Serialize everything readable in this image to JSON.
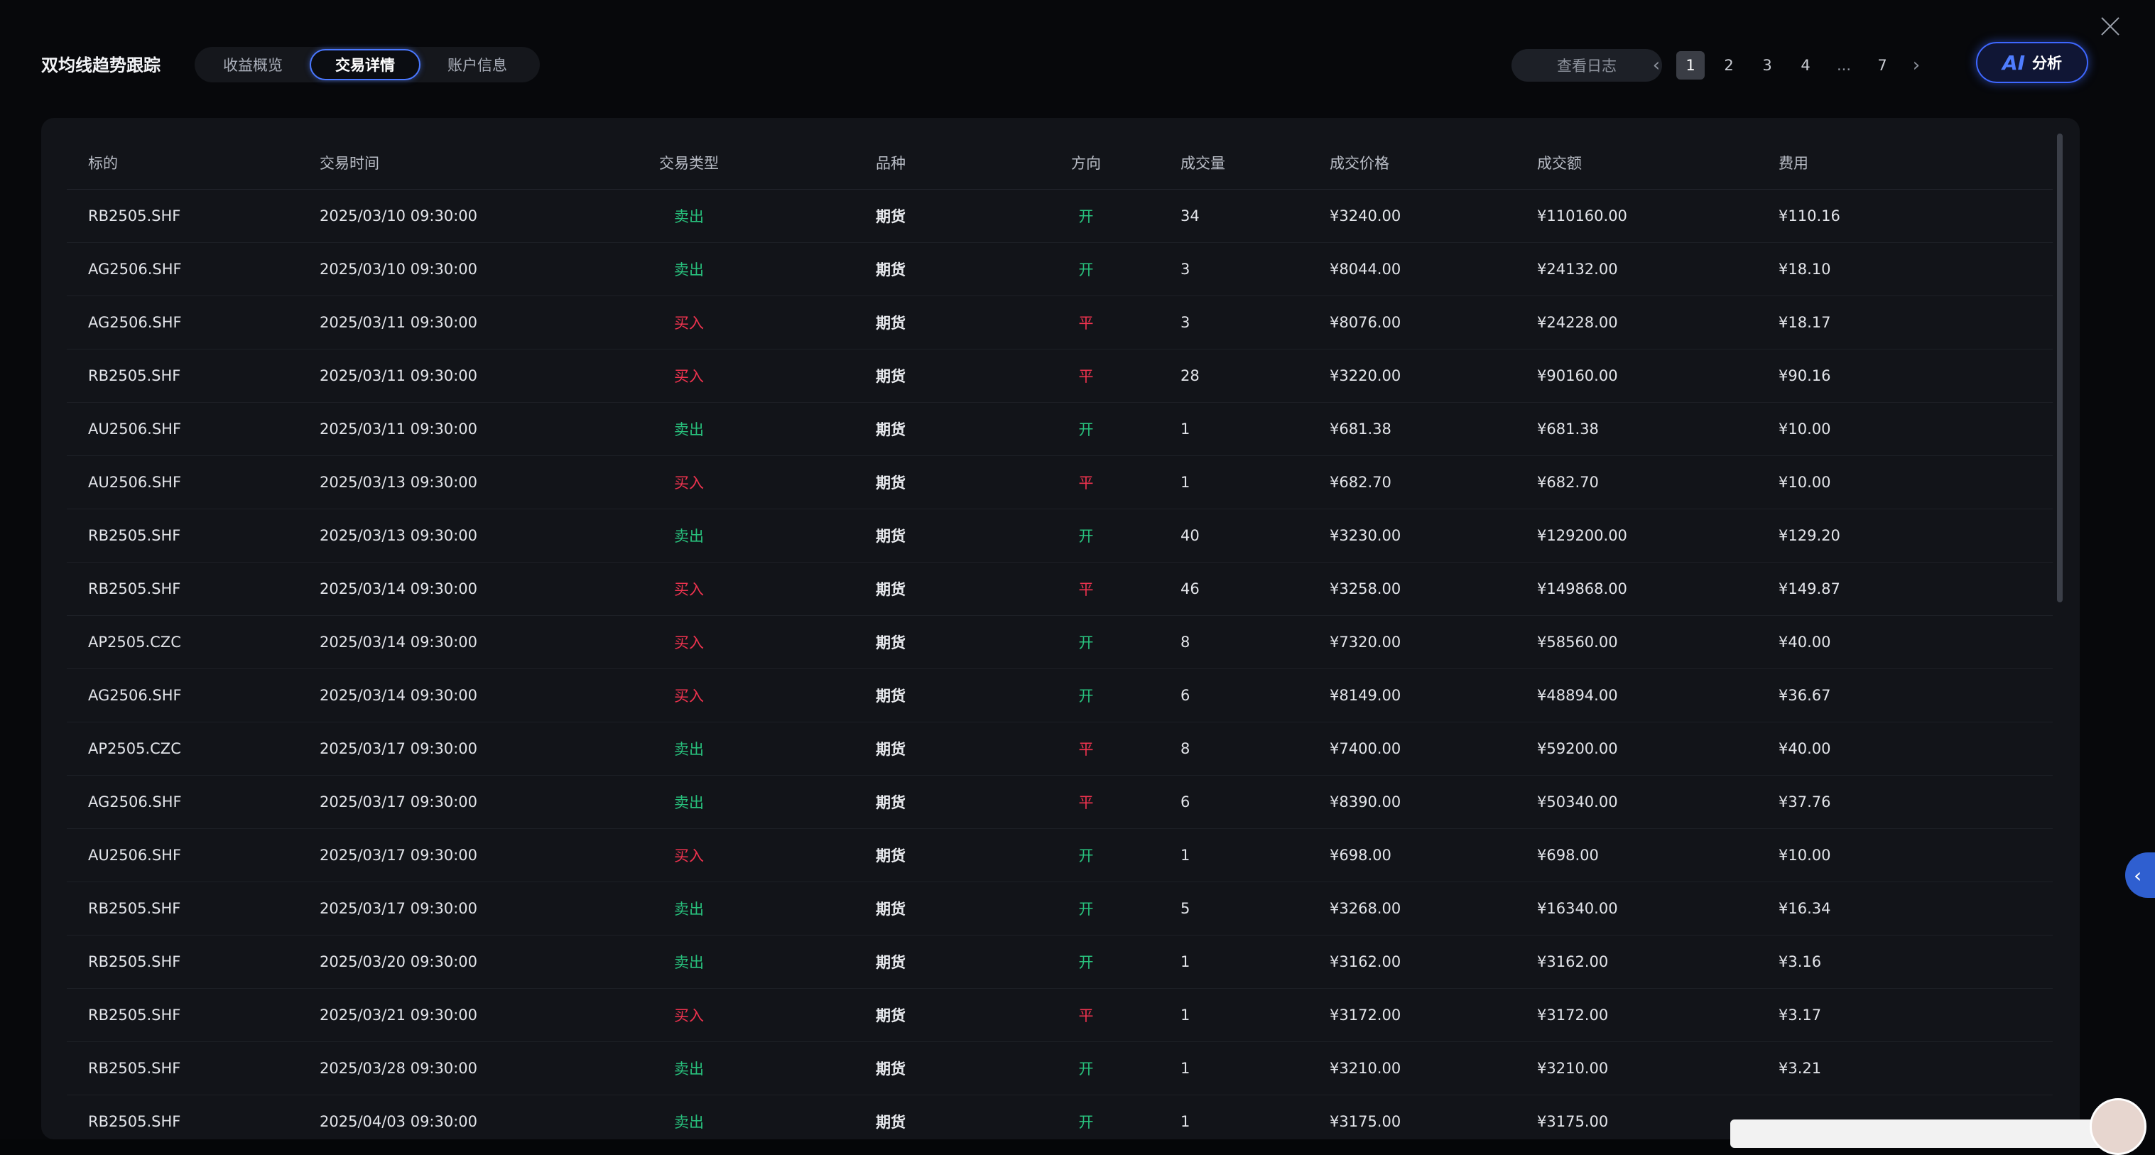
{
  "header": {
    "title": "双均线趋势跟踪",
    "tabs": [
      {
        "label": "收益概览",
        "active": false
      },
      {
        "label": "交易详情",
        "active": true
      },
      {
        "label": "账户信息",
        "active": false
      }
    ],
    "log_button": "查看日志",
    "pagination": {
      "prev_icon": "chevron-left-icon",
      "pages": [
        "1",
        "2",
        "3",
        "4"
      ],
      "ellipsis": "...",
      "last": "7",
      "current": "1",
      "next_icon": "chevron-right-icon"
    },
    "ai_button": {
      "icon": "AI",
      "label": "分析"
    }
  },
  "table": {
    "columns": [
      "标的",
      "交易时间",
      "交易类型",
      "品种",
      "方向",
      "成交量",
      "成交价格",
      "成交额",
      "费用"
    ],
    "rows": [
      {
        "symbol": "RB2505.SHF",
        "time": "2025/03/10 09:30:00",
        "type": "卖出",
        "variety": "期货",
        "direction": "开",
        "volume": "34",
        "price": "¥3240.00",
        "amount": "¥110160.00",
        "fee": "¥110.16"
      },
      {
        "symbol": "AG2506.SHF",
        "time": "2025/03/10 09:30:00",
        "type": "卖出",
        "variety": "期货",
        "direction": "开",
        "volume": "3",
        "price": "¥8044.00",
        "amount": "¥24132.00",
        "fee": "¥18.10"
      },
      {
        "symbol": "AG2506.SHF",
        "time": "2025/03/11 09:30:00",
        "type": "买入",
        "variety": "期货",
        "direction": "平",
        "volume": "3",
        "price": "¥8076.00",
        "amount": "¥24228.00",
        "fee": "¥18.17"
      },
      {
        "symbol": "RB2505.SHF",
        "time": "2025/03/11 09:30:00",
        "type": "买入",
        "variety": "期货",
        "direction": "平",
        "volume": "28",
        "price": "¥3220.00",
        "amount": "¥90160.00",
        "fee": "¥90.16"
      },
      {
        "symbol": "AU2506.SHF",
        "time": "2025/03/11 09:30:00",
        "type": "卖出",
        "variety": "期货",
        "direction": "开",
        "volume": "1",
        "price": "¥681.38",
        "amount": "¥681.38",
        "fee": "¥10.00"
      },
      {
        "symbol": "AU2506.SHF",
        "time": "2025/03/13 09:30:00",
        "type": "买入",
        "variety": "期货",
        "direction": "平",
        "volume": "1",
        "price": "¥682.70",
        "amount": "¥682.70",
        "fee": "¥10.00"
      },
      {
        "symbol": "RB2505.SHF",
        "time": "2025/03/13 09:30:00",
        "type": "卖出",
        "variety": "期货",
        "direction": "开",
        "volume": "40",
        "price": "¥3230.00",
        "amount": "¥129200.00",
        "fee": "¥129.20"
      },
      {
        "symbol": "RB2505.SHF",
        "time": "2025/03/14 09:30:00",
        "type": "买入",
        "variety": "期货",
        "direction": "平",
        "volume": "46",
        "price": "¥3258.00",
        "amount": "¥149868.00",
        "fee": "¥149.87"
      },
      {
        "symbol": "AP2505.CZC",
        "time": "2025/03/14 09:30:00",
        "type": "买入",
        "variety": "期货",
        "direction": "开",
        "volume": "8",
        "price": "¥7320.00",
        "amount": "¥58560.00",
        "fee": "¥40.00"
      },
      {
        "symbol": "AG2506.SHF",
        "time": "2025/03/14 09:30:00",
        "type": "买入",
        "variety": "期货",
        "direction": "开",
        "volume": "6",
        "price": "¥8149.00",
        "amount": "¥48894.00",
        "fee": "¥36.67"
      },
      {
        "symbol": "AP2505.CZC",
        "time": "2025/03/17 09:30:00",
        "type": "卖出",
        "variety": "期货",
        "direction": "平",
        "volume": "8",
        "price": "¥7400.00",
        "amount": "¥59200.00",
        "fee": "¥40.00"
      },
      {
        "symbol": "AG2506.SHF",
        "time": "2025/03/17 09:30:00",
        "type": "卖出",
        "variety": "期货",
        "direction": "平",
        "volume": "6",
        "price": "¥8390.00",
        "amount": "¥50340.00",
        "fee": "¥37.76"
      },
      {
        "symbol": "AU2506.SHF",
        "time": "2025/03/17 09:30:00",
        "type": "买入",
        "variety": "期货",
        "direction": "开",
        "volume": "1",
        "price": "¥698.00",
        "amount": "¥698.00",
        "fee": "¥10.00"
      },
      {
        "symbol": "RB2505.SHF",
        "time": "2025/03/17 09:30:00",
        "type": "卖出",
        "variety": "期货",
        "direction": "开",
        "volume": "5",
        "price": "¥3268.00",
        "amount": "¥16340.00",
        "fee": "¥16.34"
      },
      {
        "symbol": "RB2505.SHF",
        "time": "2025/03/20 09:30:00",
        "type": "卖出",
        "variety": "期货",
        "direction": "开",
        "volume": "1",
        "price": "¥3162.00",
        "amount": "¥3162.00",
        "fee": "¥3.16"
      },
      {
        "symbol": "RB2505.SHF",
        "time": "2025/03/21 09:30:00",
        "type": "买入",
        "variety": "期货",
        "direction": "平",
        "volume": "1",
        "price": "¥3172.00",
        "amount": "¥3172.00",
        "fee": "¥3.17"
      },
      {
        "symbol": "RB2505.SHF",
        "time": "2025/03/28 09:30:00",
        "type": "卖出",
        "variety": "期货",
        "direction": "开",
        "volume": "1",
        "price": "¥3210.00",
        "amount": "¥3210.00",
        "fee": "¥3.21"
      },
      {
        "symbol": "RB2505.SHF",
        "time": "2025/04/03 09:30:00",
        "type": "卖出",
        "variety": "期货",
        "direction": "开",
        "volume": "1",
        "price": "¥3175.00",
        "amount": "¥3175.00",
        "fee": ""
      }
    ]
  },
  "colors": {
    "sell": "#28c27d",
    "buy": "#f0334f",
    "accent": "#4a78ff"
  },
  "icons": {
    "close": "close-icon",
    "side_collapse": "chevron-left-icon"
  }
}
